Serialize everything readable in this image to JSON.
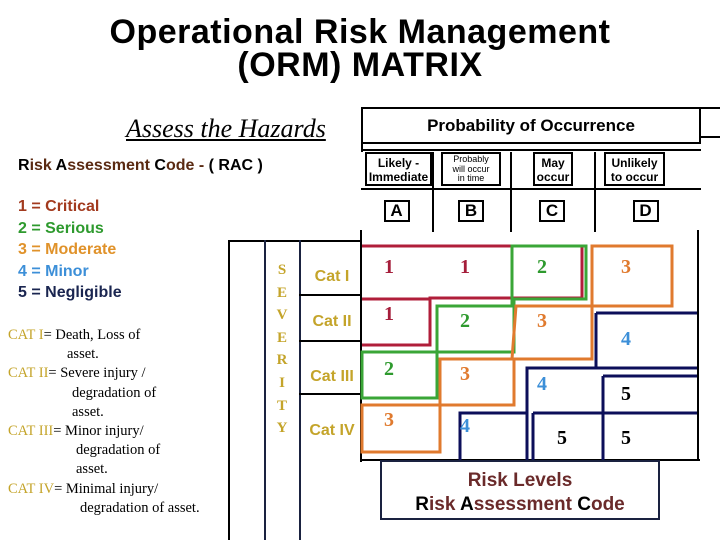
{
  "title": {
    "line1": "Operational Risk Management",
    "line2": "(ORM) MATRIX"
  },
  "assess_heading": "Assess the Hazards",
  "rac_heading": {
    "r": "R",
    "isk": "isk ",
    "a": "A",
    "ssessment": "ssessment ",
    "c": "C",
    "ode": "ode - ",
    "acronym": "( RAC )"
  },
  "rac_legend": [
    {
      "code": "1",
      "label": "1 = Critical",
      "color": "#a23a1e"
    },
    {
      "code": "2",
      "label": "2 = Serious",
      "color": "#2e9a2e"
    },
    {
      "code": "3",
      "label": "3 = Moderate",
      "color": "#e0922a"
    },
    {
      "code": "4",
      "label": "4 = Minor",
      "color": "#3c8fd8"
    },
    {
      "code": "5",
      "label": "5 = Negligible",
      "color": "#1a2550"
    }
  ],
  "category_definitions": [
    {
      "name": "CAT I",
      "lines": [
        "= Death, Loss of",
        "asset."
      ]
    },
    {
      "name": "CAT II",
      "lines": [
        "=  Severe injury /",
        "degradation of",
        "asset."
      ]
    },
    {
      "name": "CAT III",
      "lines": [
        "= Minor injury/",
        "degradation of",
        "asset."
      ]
    },
    {
      "name": "CAT IV",
      "lines": [
        "= Minimal injury/",
        "degradation of asset."
      ]
    }
  ],
  "probability": {
    "title": "Probability of Occurrence",
    "columns": [
      {
        "label_lines": [
          "Likely -",
          "Immediate"
        ],
        "letter": "A"
      },
      {
        "label_lines": [
          "Probably",
          "will occur",
          "in time"
        ],
        "letter": "B"
      },
      {
        "label_lines": [
          "May",
          "occur"
        ],
        "letter": "C"
      },
      {
        "label_lines": [
          "Unlikely",
          "to occur"
        ],
        "letter": "D"
      }
    ]
  },
  "severity": {
    "label_letters": [
      "S",
      "E",
      "V",
      "E",
      "R",
      "I",
      "T",
      "Y"
    ],
    "rows": [
      "Cat I",
      "Cat II",
      "Cat III",
      "Cat IV"
    ]
  },
  "matrix": [
    [
      "1",
      "1",
      "2",
      "3"
    ],
    [
      "1",
      "2",
      "3",
      "4"
    ],
    [
      "2",
      "3",
      "4",
      "5"
    ],
    [
      "3",
      "4",
      "5",
      "5"
    ]
  ],
  "level_colors": {
    "1": "#b01e3a",
    "2": "#3aa637",
    "3": "#e07a2e",
    "4": "#0c0f5a",
    "5": "#0c0f5a"
  },
  "number_colors": {
    "1": "#a51d3a",
    "2": "#2e9a2e",
    "3": "#e07a2e",
    "4": "#3c8fd8",
    "5": "#000000"
  },
  "risk_levels_box": {
    "line1": "Risk Levels",
    "line2": {
      "r": "R",
      "isk": "isk ",
      "a": "A",
      "ssessment": "ssessment ",
      "c": "C",
      "ode": "ode"
    }
  }
}
